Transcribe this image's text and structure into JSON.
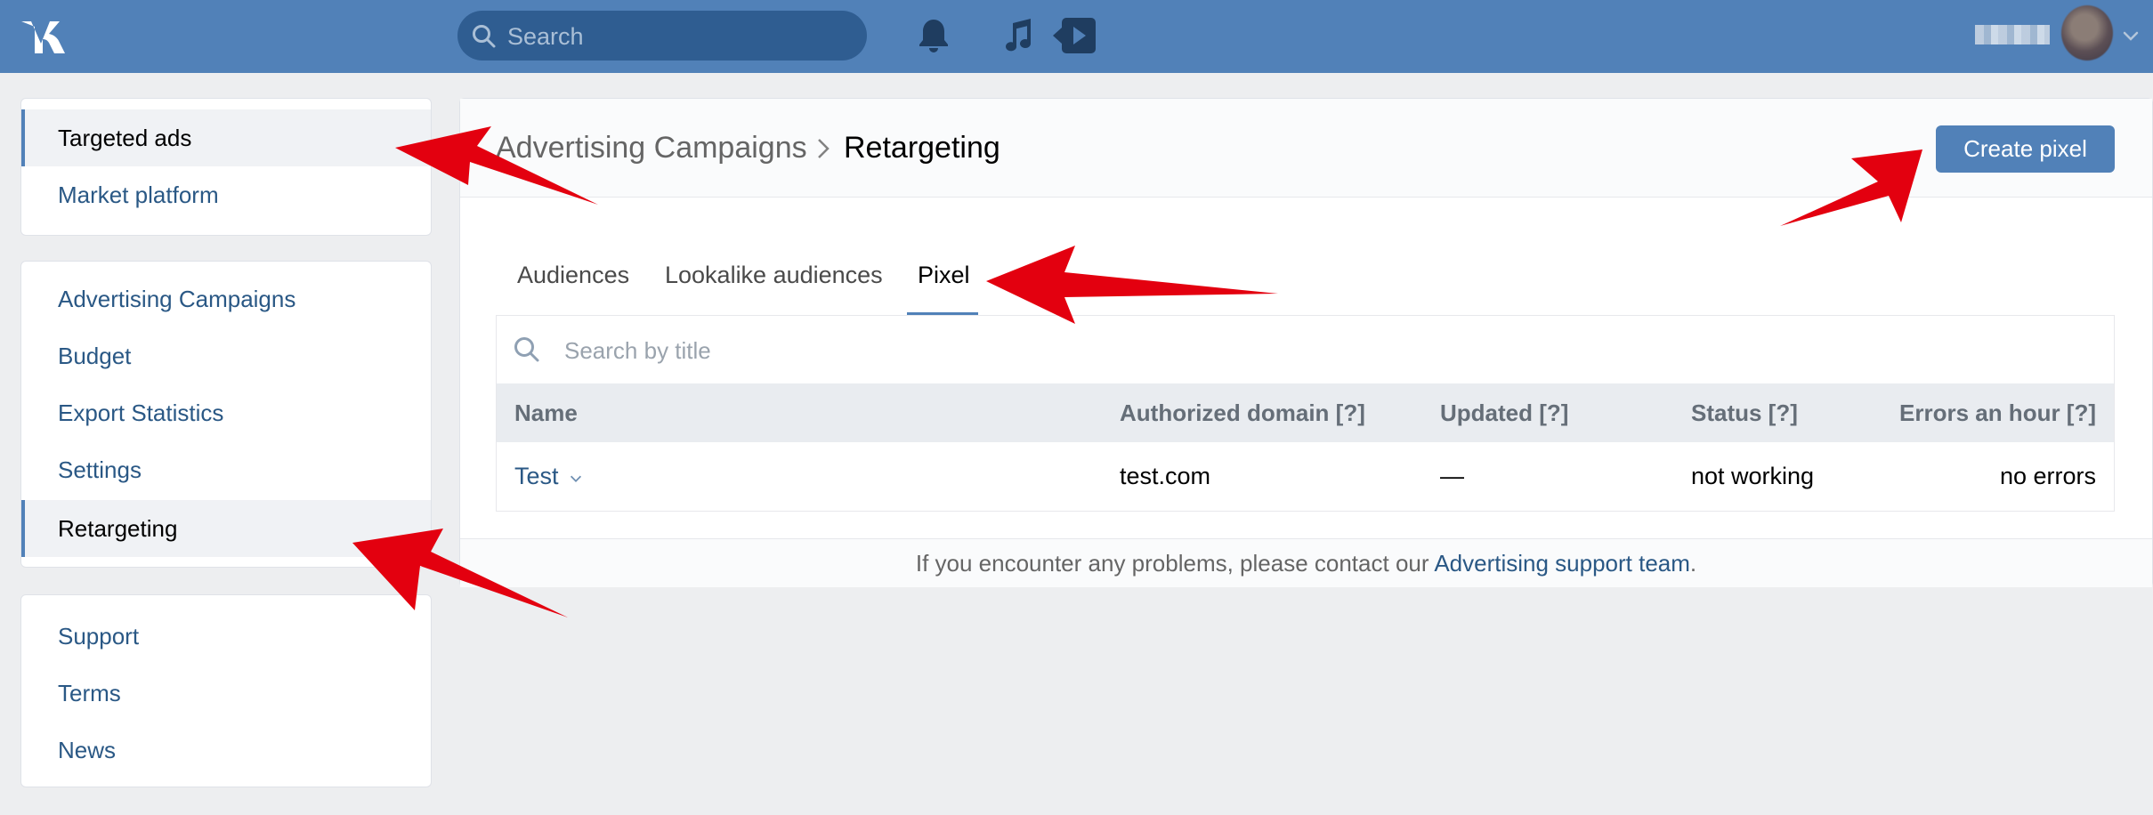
{
  "header": {
    "search_placeholder": "Search"
  },
  "left_menu": {
    "group1": [
      "Targeted ads",
      "Market platform"
    ],
    "group2": [
      "Advertising Campaigns",
      "Budget",
      "Export Statistics",
      "Settings",
      "Retargeting"
    ],
    "group3": [
      "Support",
      "Terms",
      "News"
    ]
  },
  "main": {
    "breadcrumb_parent": "Advertising Campaigns",
    "breadcrumb_current": "Retargeting",
    "create_button": "Create pixel",
    "tabs": [
      "Audiences",
      "Lookalike audiences",
      "Pixel"
    ],
    "active_tab": "Pixel",
    "table_search_placeholder": "Search by title",
    "columns": [
      "Name",
      "Authorized domain [?]",
      "Updated [?]",
      "Status [?]",
      "Errors an hour [?]"
    ],
    "rows": [
      {
        "name": "Test",
        "domain": "test.com",
        "updated": "—",
        "status": "not working",
        "errors": "no errors"
      }
    ],
    "footer_text": "If you encounter any problems, please contact our ",
    "footer_link": "Advertising support team",
    "footer_end": "."
  },
  "colors": {
    "brand_blue": "#5181b8",
    "link_blue": "#2a5885",
    "background": "#edeef0",
    "arrow_red": "#e3000f"
  }
}
